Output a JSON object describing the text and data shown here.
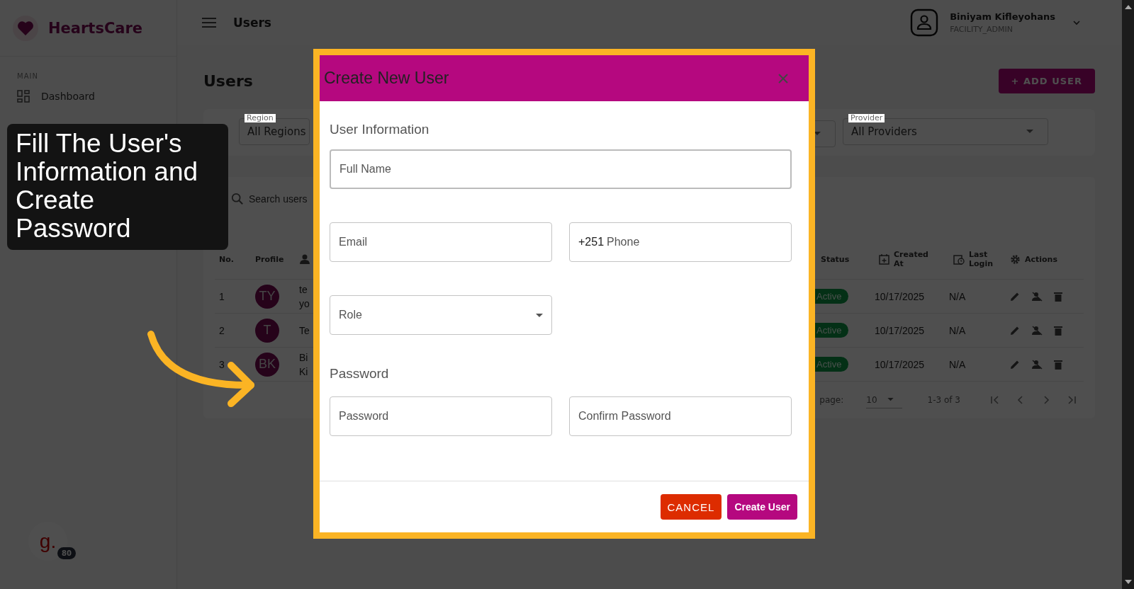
{
  "sidebar": {
    "logo": "HeartsCare",
    "section": "MAIN",
    "items": [
      {
        "label": "Dashboard"
      }
    ]
  },
  "header": {
    "title": "Users",
    "user": {
      "name": "Biniyam Kifleyohans",
      "role": "FACILITY_ADMIN"
    }
  },
  "page": {
    "title": "Users",
    "add_button": "+ ADD USER"
  },
  "filters": [
    {
      "label": "Region",
      "value": "All Regions"
    },
    {
      "label": "Provider",
      "value": "All Providers"
    }
  ],
  "table": {
    "search_placeholder": "Search users",
    "columns": [
      {
        "kind": "text",
        "label": "No."
      },
      {
        "kind": "text",
        "label": "Profile"
      },
      {
        "kind": "person"
      },
      {
        "kind": "status",
        "label": "Status"
      },
      {
        "kind": "created",
        "label": "Created At"
      },
      {
        "kind": "login",
        "label": "Last Login"
      },
      {
        "kind": "actions",
        "label": "Actions"
      }
    ],
    "rows": [
      {
        "no": "1",
        "initials": "TY",
        "name": "te yo",
        "status": "Active",
        "created": "10/17/2025",
        "last_login": "N/A"
      },
      {
        "no": "2",
        "initials": "T",
        "name": "Te",
        "status": "Active",
        "created": "10/17/2025",
        "last_login": "N/A"
      },
      {
        "no": "3",
        "initials": "BK",
        "name": "Bi Ki",
        "status": "Active",
        "created": "10/17/2025",
        "last_login": "N/A"
      }
    ],
    "pagination": {
      "rows_label": "page:",
      "rows_per_page": "10",
      "range": "1-3 of 3"
    }
  },
  "modal": {
    "title": "Create New User",
    "sections": [
      {
        "heading": "User Information",
        "rows": [
          [
            {
              "kind": "text",
              "placeholder": "Full Name",
              "focused": true
            }
          ],
          [
            {
              "kind": "text",
              "placeholder": "Email",
              "focused": false
            },
            {
              "kind": "phone",
              "prefix": "+251",
              "placeholder": "Phone",
              "focused": false
            }
          ],
          [
            {
              "kind": "select",
              "placeholder": "Role",
              "focused": false
            }
          ]
        ]
      },
      {
        "heading": "Password",
        "rows": [
          [
            {
              "kind": "text",
              "placeholder": "Password",
              "focused": false
            },
            {
              "kind": "text",
              "placeholder": "Confirm Password",
              "focused": false
            }
          ]
        ]
      }
    ],
    "buttons": [
      {
        "kind": "cancel",
        "label": "CANCEL"
      },
      {
        "kind": "primary",
        "label": "Create User"
      }
    ]
  },
  "tutorial": {
    "lines": [
      "Fill The User's",
      "Information and",
      "Create",
      "Password"
    ]
  },
  "widget": {
    "letter": "g.",
    "badge": "80"
  }
}
